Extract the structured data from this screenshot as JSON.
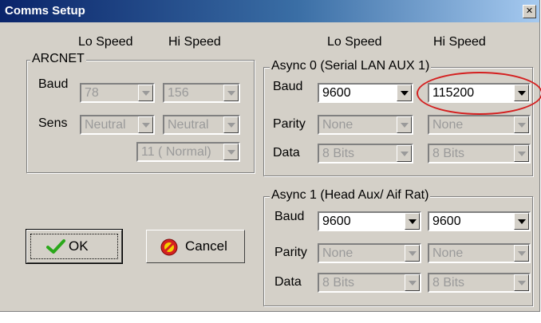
{
  "window": {
    "title": "Comms Setup",
    "close_glyph": "✕"
  },
  "headers": {
    "lo_speed": "Lo Speed",
    "hi_speed": "Hi Speed"
  },
  "arcnet": {
    "title": "ARCNET",
    "baud_label": "Baud",
    "baud_lo": "78",
    "baud_hi": "156",
    "sens_label": "Sens",
    "sens_lo": "Neutral",
    "sens_hi": "Neutral",
    "mode": "11 ( Normal)"
  },
  "async0": {
    "title": "Async 0 (Serial LAN AUX 1)",
    "baud_label": "Baud",
    "baud_lo": "9600",
    "baud_hi": "115200",
    "parity_label": "Parity",
    "parity_lo": "None",
    "parity_hi": "None",
    "data_label": "Data",
    "data_lo": "8 Bits",
    "data_hi": "8 Bits"
  },
  "async1": {
    "title": "Async 1 (Head Aux/ Aif Rat)",
    "baud_label": "Baud",
    "baud_lo": "9600",
    "baud_hi": "9600",
    "parity_label": "Parity",
    "parity_lo": "None",
    "parity_hi": "None",
    "data_label": "Data",
    "data_lo": "8 Bits",
    "data_hi": "8 Bits"
  },
  "buttons": {
    "ok": "OK",
    "cancel": "Cancel"
  },
  "annotation": {
    "highlight_color": "#d42020"
  }
}
